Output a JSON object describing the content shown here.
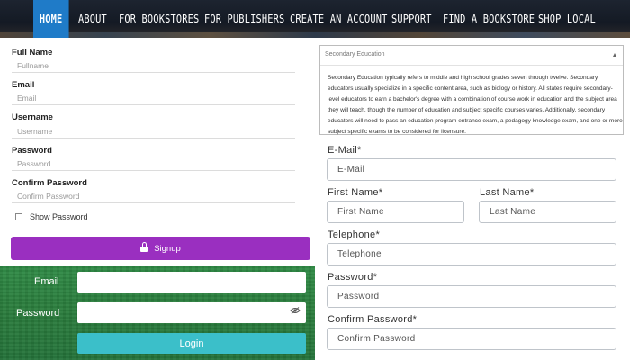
{
  "nav": {
    "items": [
      "HOME",
      "ABOUT",
      "FOR BOOKSTORES",
      "FOR PUBLISHERS",
      "CREATE AN ACCOUNT",
      "SUPPORT",
      "FIND A BOOKSTORE",
      "SHOP LOCAL"
    ],
    "active": "HOME",
    "active_color": "#1f7bc8"
  },
  "signup": {
    "fields": [
      {
        "label": "Full Name",
        "placeholder": "Fullname"
      },
      {
        "label": "Email",
        "placeholder": "Email"
      },
      {
        "label": "Username",
        "placeholder": "Username"
      },
      {
        "label": "Password",
        "placeholder": "Password"
      },
      {
        "label": "Confirm Password",
        "placeholder": "Confirm Password"
      }
    ],
    "show_password_label": "Show Password",
    "button_label": "Signup",
    "button_color": "#9a2fc0"
  },
  "login": {
    "email_label": "Email",
    "password_label": "Password",
    "button_label": "Login",
    "button_color": "#3bbfc9",
    "panel_color": "#2a7c3c"
  },
  "info": {
    "select_label": "Secondary Education",
    "text": "Secondary Education typically refers to middle and high school grades seven through twelve. Secondary educators usually specialize in a specific content area, such as biology or history. All states require secondary-level educators to earn a bachelor's degree with a combination of course work in education and the subject area they will teach, though the number of education and subject specific courses varies. Additionally, secondary educators will need to pass an education program entrance exam, a pedagogy knowledge exam, and one or more subject specific exams to be considered for licensure."
  },
  "register": {
    "email_label": "E-Mail*",
    "email_placeholder": "E-Mail",
    "first_name_label": "First Name*",
    "first_name_placeholder": "First Name",
    "last_name_label": "Last Name*",
    "last_name_placeholder": "Last Name",
    "telephone_label": "Telephone*",
    "telephone_placeholder": "Telephone",
    "password_label": "Password*",
    "password_placeholder": "Password",
    "confirm_password_label": "Confirm Password*",
    "confirm_password_placeholder": "Confirm Password"
  }
}
